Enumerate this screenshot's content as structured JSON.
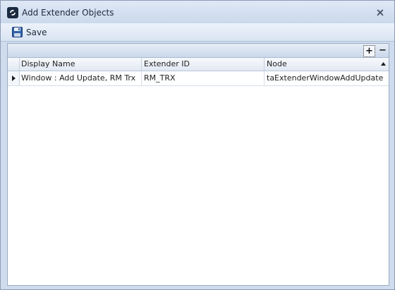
{
  "window": {
    "title": "Add Extender Objects",
    "app_icon": "extender-logo-icon",
    "close_icon": "close-icon"
  },
  "toolbar": {
    "save_label": "Save",
    "save_icon": "floppy-disk-icon"
  },
  "grid": {
    "add_label": "+",
    "remove_label": "−",
    "columns": [
      {
        "label": "Display Name"
      },
      {
        "label": "Extender ID"
      },
      {
        "label": "Node",
        "sort": "ascending"
      }
    ],
    "rows": [
      {
        "display_name": "Window : Add Update, RM Trx",
        "extender_id": "RM_TRX",
        "node": "taExtenderWindowAddUpdate",
        "current": true
      }
    ]
  },
  "colors": {
    "frame": "#cfdced",
    "toolbar": "#d9e4f2",
    "grid_background": "#ffffff"
  }
}
